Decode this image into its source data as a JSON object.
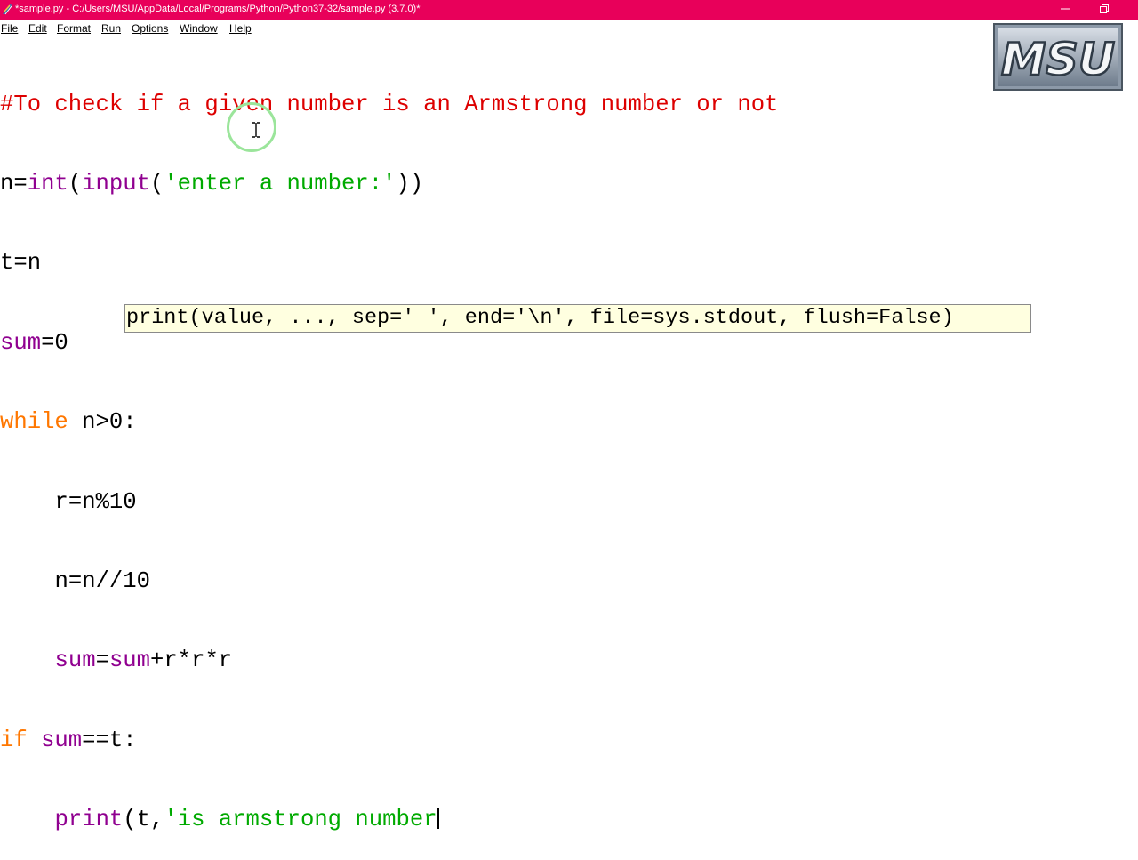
{
  "window": {
    "title": "*sample.py - C:/Users/MSU/AppData/Local/Programs/Python/Python37-32/sample.py (3.7.0)*",
    "title_bg": "#e8005a",
    "app_icon": "python-feather-icon",
    "minimize_icon": "minimize-icon",
    "restore_icon": "restore-icon"
  },
  "menu": {
    "items": [
      {
        "label": "File"
      },
      {
        "label": "Edit"
      },
      {
        "label": "Format"
      },
      {
        "label": "Run"
      },
      {
        "label": "Options"
      },
      {
        "label": "Window"
      },
      {
        "label": "Help"
      }
    ]
  },
  "editor": {
    "lines": [
      {
        "comment": "#To check if a given number is an Armstrong number or not"
      },
      {
        "p1": "n=",
        "b1": "int",
        "p2": "(",
        "b2": "input",
        "p3": "(",
        "s1": "'enter a number:'",
        "p4": "))"
      },
      {
        "p1": "t=n"
      },
      {
        "b1": "sum",
        "p1": "=0"
      },
      {
        "k1": "while",
        "p1": " n>0:"
      },
      {
        "p1": "r=n%10"
      },
      {
        "p1": "n=n//10"
      },
      {
        "b1": "sum",
        "p1": "=",
        "b2": "sum",
        "p2": "+r*r*r"
      },
      {
        "k1": "if",
        "p1": " ",
        "b1": "sum",
        "p2": "==t:"
      },
      {
        "b1": "print",
        "p1": "(t,",
        "s1": "'is armstrong number"
      }
    ],
    "colors": {
      "comment": "#dd0000",
      "builtin": "#900090",
      "string": "#00aa00",
      "keyword": "#ff7700"
    }
  },
  "calltip": {
    "text": "print(value, ..., sep=' ', end='\\n', file=sys.stdout, flush=False)",
    "bg": "#ffffe0"
  },
  "overlay": {
    "cursor_icon": "text-cursor-icon",
    "logo_text": "MSU"
  }
}
